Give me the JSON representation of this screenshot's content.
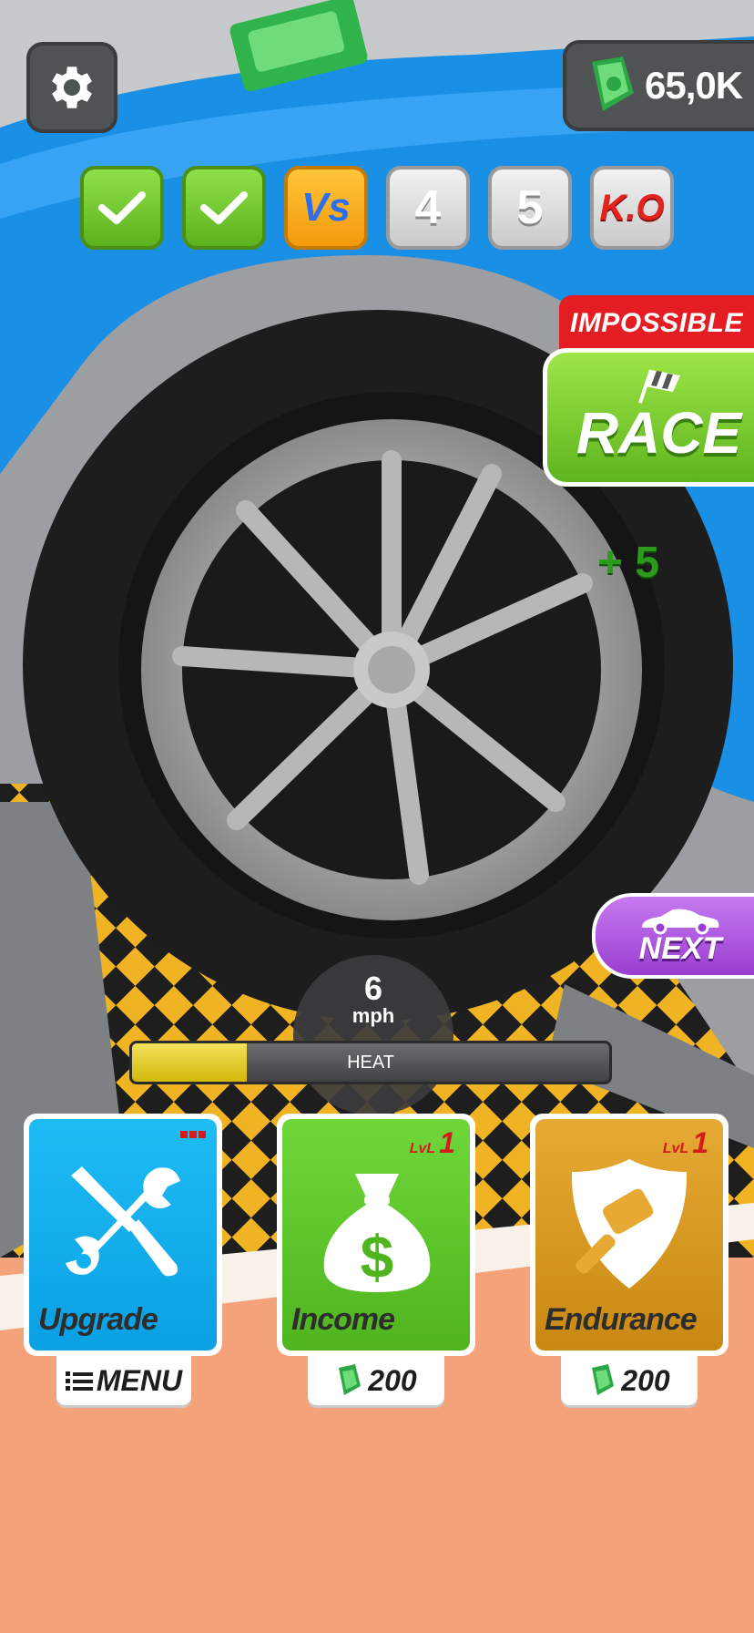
{
  "hud": {
    "money": "65,0K"
  },
  "stages": [
    {
      "label": "",
      "state": "done"
    },
    {
      "label": "",
      "state": "done"
    },
    {
      "label": "Vs",
      "state": "current"
    },
    {
      "label": "4",
      "state": "upcoming"
    },
    {
      "label": "5",
      "state": "upcoming"
    },
    {
      "label": "K.O",
      "state": "boss"
    }
  ],
  "race": {
    "difficulty": "IMPOSSIBLE",
    "label": "RACE",
    "bonus": "+ 5"
  },
  "next": {
    "label": "NEXT"
  },
  "speed": {
    "value": "6",
    "unit": "mph"
  },
  "heat": {
    "label": "HEAT",
    "level": 0.24
  },
  "cards": [
    {
      "title": "Upgrade",
      "button": "MENU",
      "icon": "wrench-screwdriver-icon",
      "color": "#0fb0f0"
    },
    {
      "title": "Income",
      "level_label": "LvL",
      "level": "1",
      "cost": "200",
      "icon": "money-bag-icon",
      "color": "#5cc42a"
    },
    {
      "title": "Endurance",
      "level_label": "LvL",
      "level": "1",
      "cost": "200",
      "icon": "shield-hammer-icon",
      "color": "#d79a1c"
    }
  ],
  "colors": {
    "car_blue": "#1a8fe6",
    "accent_green": "#5eb51f",
    "accent_red": "#e31d22",
    "accent_purple": "#9a3ed1"
  }
}
